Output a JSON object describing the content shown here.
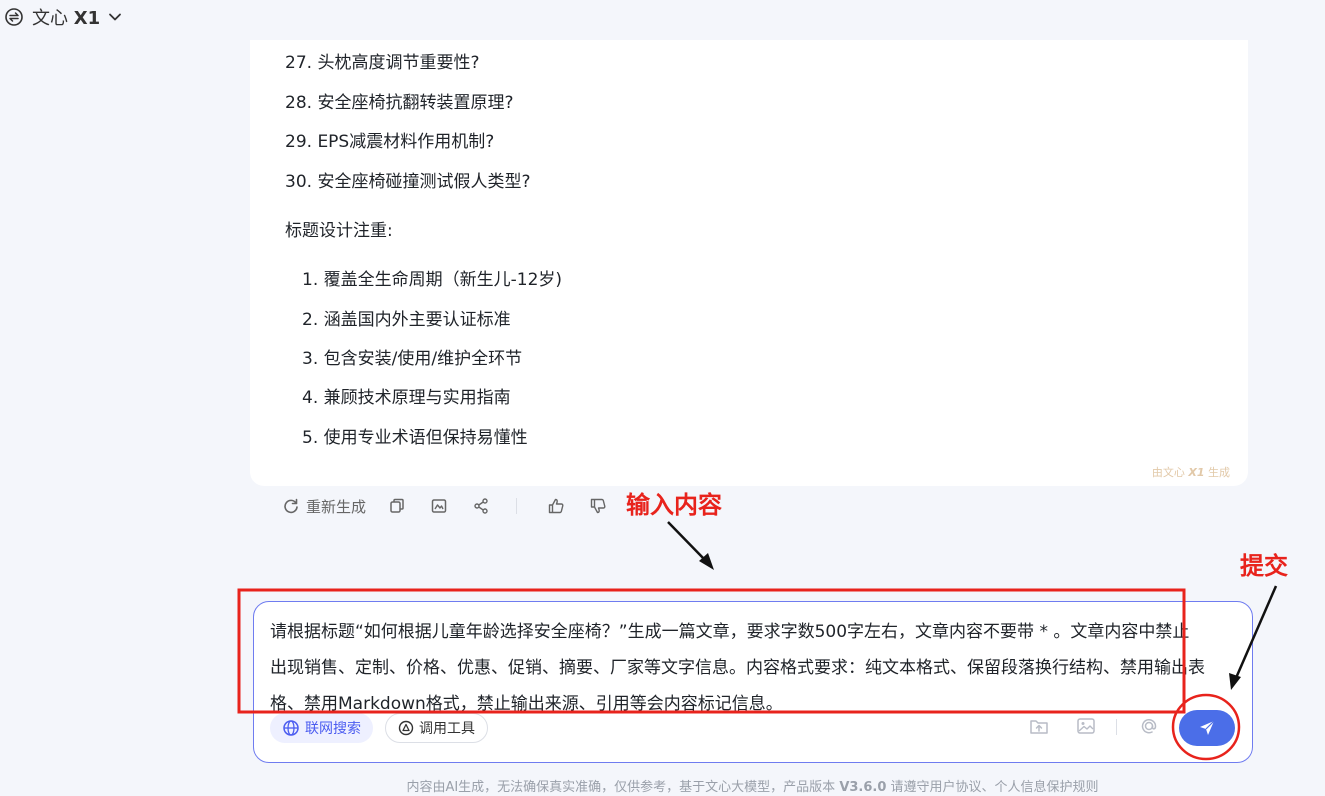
{
  "header": {
    "model_prefix": "文心",
    "model_suffix": "X1"
  },
  "answer": {
    "questions": [
      "27. 头枕高度调节重要性?",
      "28. 安全座椅抗翻转装置原理?",
      "29. EPS减震材料作用机制?",
      "30. 安全座椅碰撞测试假人类型?"
    ],
    "note_title": "标题设计注重:",
    "points": [
      "1. 覆盖全生命周期（新生儿-12岁)",
      "2. 涵盖国内外主要认证标准",
      "3. 包含安装/使用/维护全环节",
      "4. 兼顾技术原理与实用指南",
      "5. 使用专业术语但保持易懂性"
    ],
    "watermark_prefix": "由文心",
    "watermark_model": "X1",
    "watermark_suffix": "生成"
  },
  "actions": {
    "regenerate_label": "重新生成"
  },
  "annotations": {
    "input_label": "输入内容",
    "submit_label": "提交"
  },
  "input": {
    "text": "请根据标题“如何根据儿童年龄选择安全座椅？”生成一篇文章，要求字数500字左右，文章内容不要带 * 。文章内容中禁止出现销售、定制、价格、优惠、促销、摘要、厂家等文字信息。内容格式要求：纯文本格式、保留段落换行结构、禁用输出表格、禁用Markdown格式，禁止输出来源、引用等会内容标记信息。",
    "web_search_label": "联网搜索",
    "tools_label": "调用工具"
  },
  "footer": {
    "prefix": "内容由AI生成，无法确保真实准确，仅供参考，基于文心大模型，产品版本 ",
    "version": "V3.6.0",
    "suffix": " 请遵守用户协议、个人信息保护规则"
  }
}
